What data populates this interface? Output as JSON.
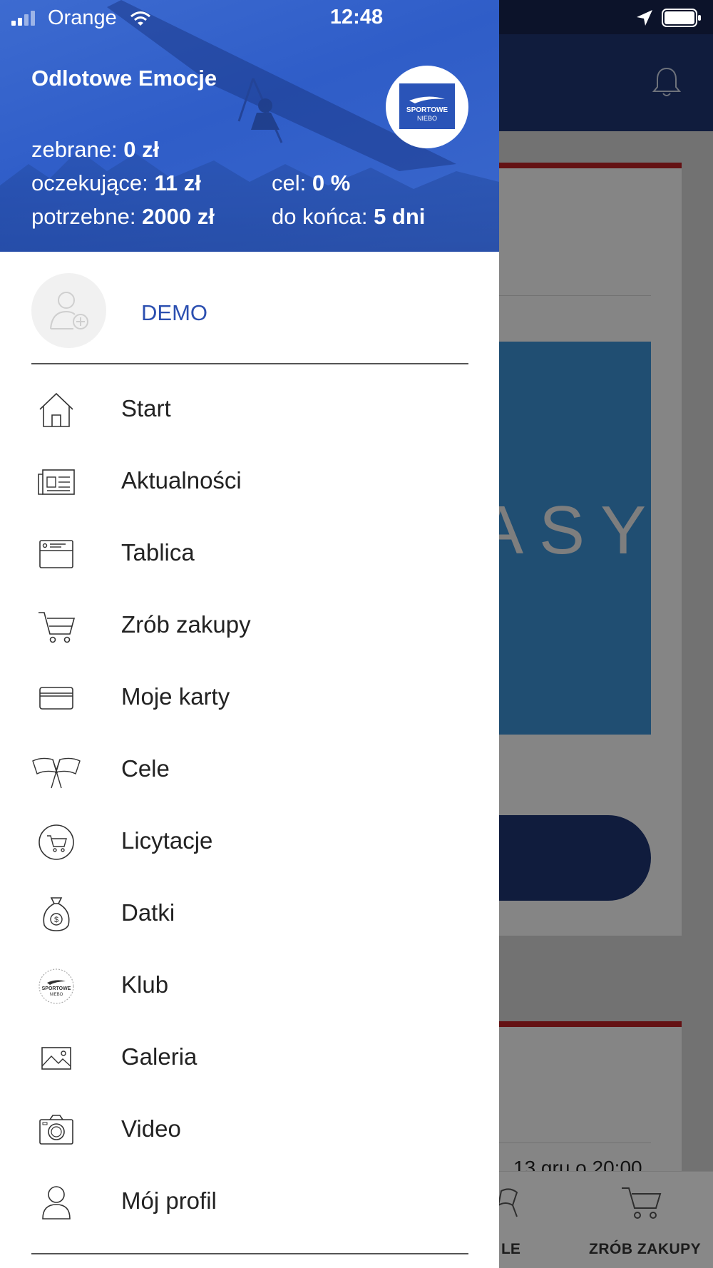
{
  "status_bar": {
    "carrier": "Orange",
    "time": "12:48"
  },
  "drawer": {
    "campaign_title": "Odlotowe Emocje",
    "stats": {
      "collected_label": "zebrane:",
      "collected_value": "0 zł",
      "pending_label": "oczekujące:",
      "pending_value": "11 zł",
      "needed_label": "potrzebne:",
      "needed_value": "2000 zł",
      "goal_label": "cel:",
      "goal_value": "0 %",
      "remaining_label": "do końca:",
      "remaining_value": "5 dni"
    },
    "club_logo_text": "SPORTOWE NIEBO",
    "user_name": "DEMO",
    "menu": [
      {
        "label": "Start",
        "icon": "home-icon"
      },
      {
        "label": "Aktualności",
        "icon": "newspaper-icon"
      },
      {
        "label": "Tablica",
        "icon": "board-icon"
      },
      {
        "label": "Zrób zakupy",
        "icon": "cart-icon"
      },
      {
        "label": "Moje karty",
        "icon": "card-icon"
      },
      {
        "label": "Cele",
        "icon": "flags-icon"
      },
      {
        "label": "Licytacje",
        "icon": "auction-cart-icon"
      },
      {
        "label": "Datki",
        "icon": "money-bag-icon"
      },
      {
        "label": "Klub",
        "icon": "club-logo-icon"
      },
      {
        "label": "Galeria",
        "icon": "gallery-icon"
      },
      {
        "label": "Video",
        "icon": "camera-icon"
      },
      {
        "label": "Mój profil",
        "icon": "profile-icon"
      }
    ]
  },
  "background": {
    "banner_text": "ASY",
    "event_date": "13 gru o 20:00",
    "tab_goals_label": "LE",
    "tab_shop_label": "ZRÓB ZAKUPY"
  },
  "colors": {
    "header_blue": "#3d6bd0",
    "user_name_blue": "#2b4fb0",
    "app_navy": "#1e3470",
    "accent_red": "#b61f24"
  }
}
